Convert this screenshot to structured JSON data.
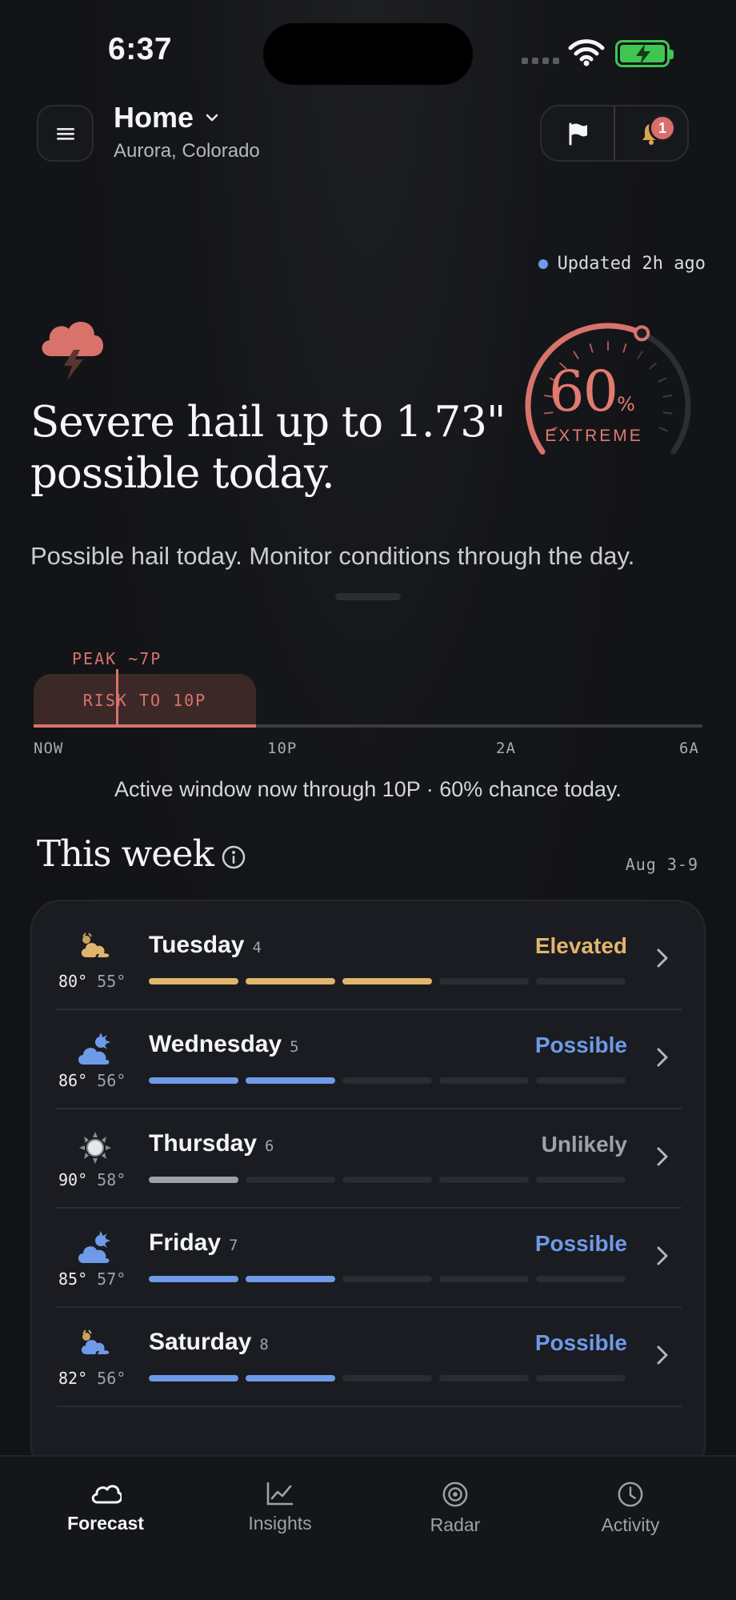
{
  "status_bar": {
    "time": "6:37"
  },
  "header": {
    "location_name": "Home",
    "location_sub": "Aurora, Colorado",
    "notification_count": "1"
  },
  "hero": {
    "updated": "Updated 2h ago",
    "headline": "Severe hail up to 1.73\" possible today.",
    "description": "Possible hail today. Monitor conditions through the day.",
    "gauge_value": "60",
    "gauge_unit": "%",
    "gauge_level": 0.6,
    "gauge_label": "EXTREME",
    "accent_color": "#e27a6f"
  },
  "timeline": {
    "peak_label": "PEAK ~7P",
    "risk_label": "RISK TO 10P",
    "ticks": [
      "NOW",
      "10P",
      "2A",
      "6A"
    ],
    "summary": "Active window now through 10P · 60% chance today."
  },
  "week": {
    "title": "This week",
    "range": "Aug 3-9",
    "days": [
      {
        "name": "Tuesday",
        "num": "4",
        "hi": "80°",
        "lo": "55°",
        "level": "Elevated",
        "level_color": "#e2b56c",
        "bars": 3,
        "icon": "storm-sun-icon"
      },
      {
        "name": "Wednesday",
        "num": "5",
        "hi": "86°",
        "lo": "56°",
        "level": "Possible",
        "level_color": "#6f9ae8",
        "bars": 2,
        "icon": "partly-cloudy-icon"
      },
      {
        "name": "Thursday",
        "num": "6",
        "hi": "90°",
        "lo": "58°",
        "level": "Unlikely",
        "level_color": "#9ea1a8",
        "bars": 1,
        "icon": "sun-icon"
      },
      {
        "name": "Friday",
        "num": "7",
        "hi": "85°",
        "lo": "57°",
        "level": "Possible",
        "level_color": "#6f9ae8",
        "bars": 2,
        "icon": "partly-cloudy-icon"
      },
      {
        "name": "Saturday",
        "num": "8",
        "hi": "82°",
        "lo": "56°",
        "level": "Possible",
        "level_color": "#6f9ae8",
        "bars": 2,
        "icon": "storm-sun-icon"
      }
    ]
  },
  "tabs": [
    {
      "label": "Forecast",
      "icon": "cloud-icon",
      "active": true
    },
    {
      "label": "Insights",
      "icon": "chart-icon",
      "active": false
    },
    {
      "label": "Radar",
      "icon": "radar-icon",
      "active": false
    },
    {
      "label": "Activity",
      "icon": "clock-icon",
      "active": false
    }
  ]
}
